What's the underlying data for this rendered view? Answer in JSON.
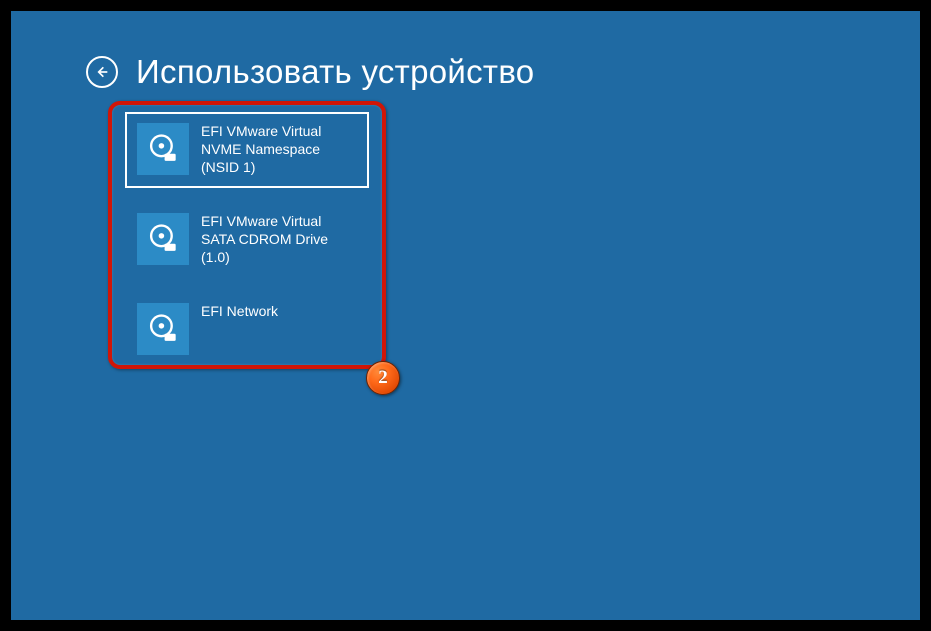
{
  "header": {
    "title": "Использовать устройство"
  },
  "devices": [
    {
      "label": "EFI VMware Virtual NVME Namespace (NSID 1)",
      "selected": true
    },
    {
      "label": "EFI VMware Virtual SATA CDROM Drive (1.0)",
      "selected": false
    },
    {
      "label": "EFI Network",
      "selected": false
    }
  ],
  "annotation": {
    "badge": "2"
  }
}
